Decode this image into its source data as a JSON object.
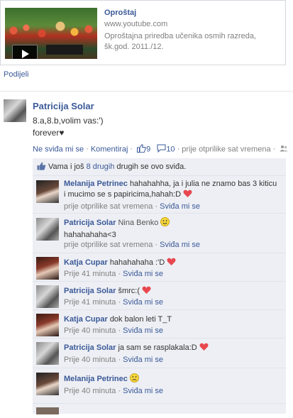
{
  "link_card": {
    "title": "Oproštaj",
    "source": "www.youtube.com",
    "description": "Oproštajna priredba učenika osmih razreda, šk.god. 2011./12."
  },
  "share_label": "Podijeli",
  "post": {
    "author": "Patricija Solar",
    "line1": "8.a,8.b,volim vas:')",
    "line2": "forever♥",
    "unlike": "Ne sviđa mi se",
    "comment": "Komentiraj",
    "like_count": "9",
    "comment_count": "10",
    "time": "prije otprilike sat vremena",
    "likes_prefix": "Vama i još ",
    "likes_link": "8 drugih",
    "likes_suffix": " drugih se ovo sviđa."
  },
  "comments": [
    {
      "author": "Melanija Petrinec",
      "text": "hahahahha, ja i julia ne znamo bas 3 kiticu i mucimo se s papiricima,hahah:D",
      "emoji": "heart",
      "time": "prije otprilike sat vremena",
      "like": "Sviđa mi se"
    },
    {
      "author": "Patricija Solar",
      "text": "Nina Benko",
      "text2": "hahahahaha<3",
      "emoji": "smile",
      "time": "prije otprilike sat vremena",
      "like": "Sviđa mi se"
    },
    {
      "author": "Katja Cupar",
      "text": "hahahahaha :'D",
      "emoji": "heart",
      "time": "Prije 41 minuta",
      "like": "Sviđa mi se"
    },
    {
      "author": "Patricija Solar",
      "text": "šmrc:(",
      "emoji": "heart",
      "time": "Prije 41 minuta",
      "like": "Sviđa mi se"
    },
    {
      "author": "Katja Cupar",
      "text": "dok balon leti T_T",
      "emoji": "",
      "time": "Prije 40 minuta",
      "like": "Sviđa mi se"
    },
    {
      "author": "Patricija Solar",
      "text": "ja sam se rasplakala:D",
      "emoji": "heart",
      "time": "Prije 40 minuta",
      "like": "Sviđa mi se"
    },
    {
      "author": "Melanija Petrinec",
      "text": "",
      "emoji": "smile",
      "time": "Prije 40 minuta",
      "like": "Sviđa mi se"
    }
  ],
  "separator": "·",
  "colors": {
    "link": "#3b5998",
    "meta": "#808080",
    "ufi_bg": "#edeff4",
    "heart": "#e8474f"
  }
}
